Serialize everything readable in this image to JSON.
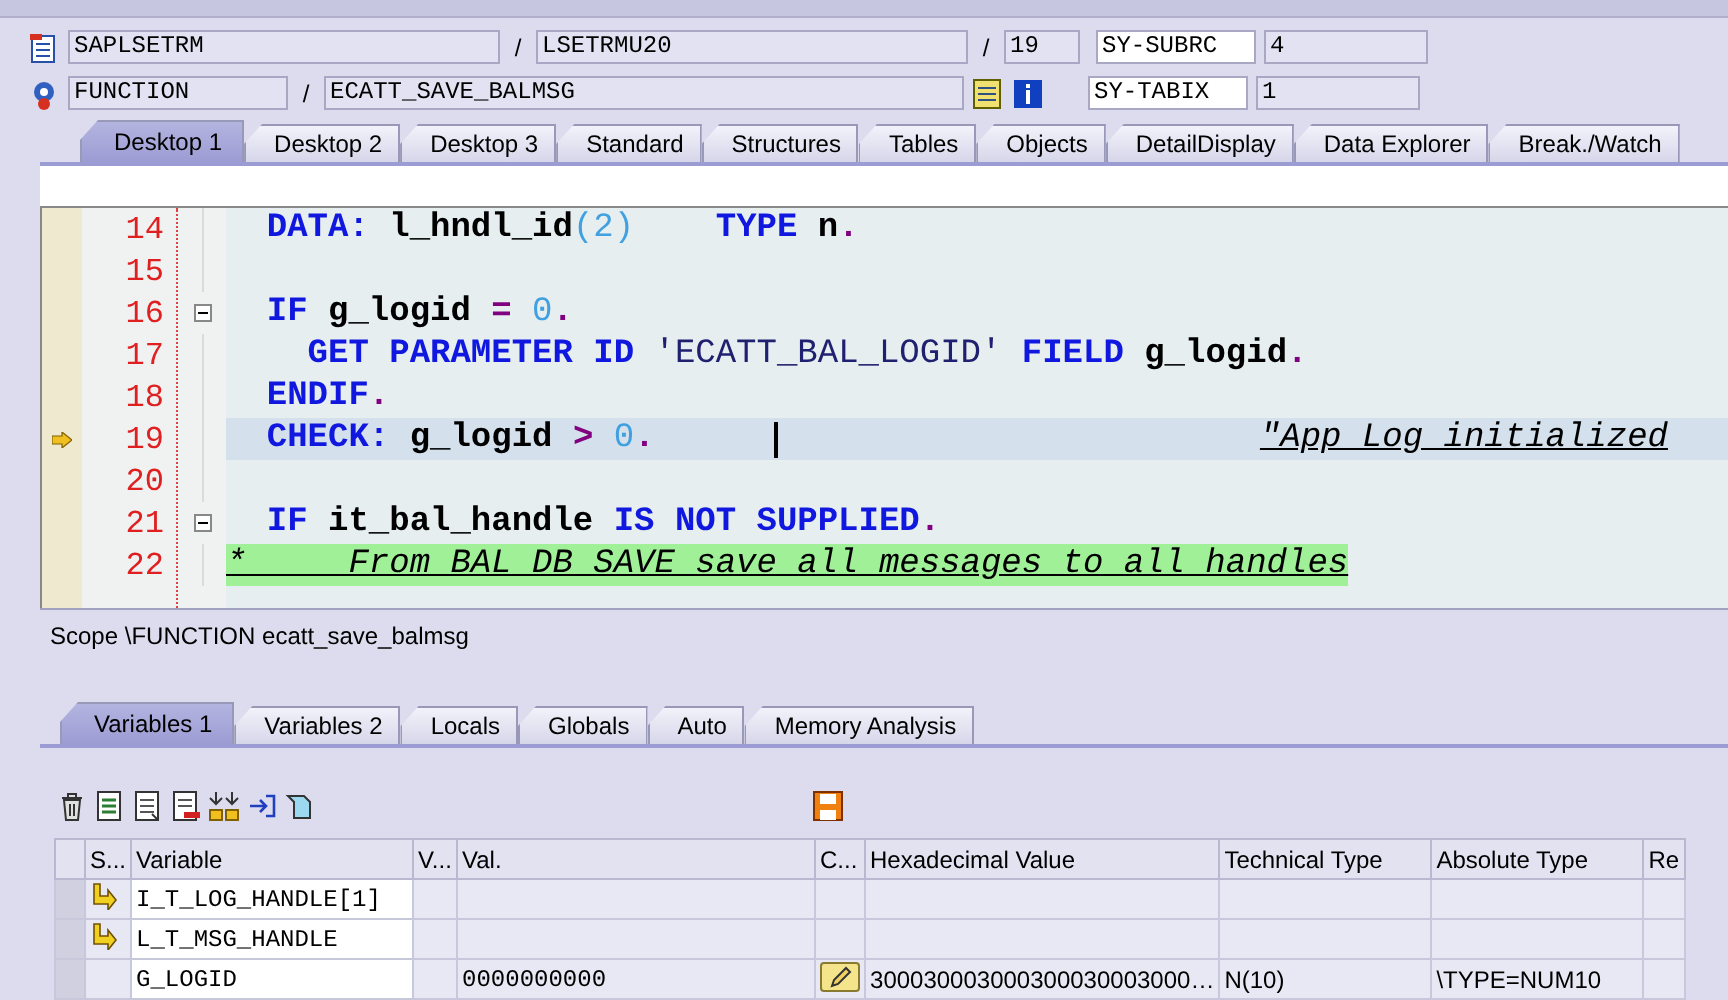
{
  "header": {
    "program_line": {
      "program": "SAPLSETRM",
      "separator_1": "/",
      "include": "LSETRMU20",
      "separator_2": "/",
      "line": "19",
      "system_field": {
        "name": "SY-SUBRC",
        "value": "4"
      }
    },
    "event_line": {
      "event_type": "FUNCTION",
      "separator": "/",
      "event": "ECATT_SAVE_BALMSG",
      "system_field": {
        "name": "SY-TABIX",
        "value": "1"
      }
    }
  },
  "desktop_tabs": [
    {
      "label": "Desktop 1",
      "selected": true
    },
    {
      "label": "Desktop 2",
      "selected": false
    },
    {
      "label": "Desktop 3",
      "selected": false
    },
    {
      "label": "Standard",
      "selected": false
    },
    {
      "label": "Structures",
      "selected": false
    },
    {
      "label": "Tables",
      "selected": false
    },
    {
      "label": "Objects",
      "selected": false
    },
    {
      "label": "DetailDisplay",
      "selected": false
    },
    {
      "label": "Data Explorer",
      "selected": false
    },
    {
      "label": "Break./Watch",
      "selected": false
    }
  ],
  "code": {
    "lines": [
      {
        "number": "14",
        "current": false,
        "fold": false,
        "kind": "code",
        "tokens": [
          {
            "kind": "keyword",
            "text": "  DATA:"
          },
          {
            "kind": "name",
            "text": " l_hndl_id"
          },
          {
            "kind": "number",
            "text": "(2)"
          },
          {
            "kind": "keyword",
            "text": "    TYPE"
          },
          {
            "kind": "name",
            "text": " n"
          },
          {
            "kind": "operator",
            "text": "."
          }
        ]
      },
      {
        "number": "15",
        "current": false,
        "fold": false
      },
      {
        "number": "16",
        "current": false,
        "fold": true,
        "kind": "code",
        "tokens": [
          {
            "kind": "keyword",
            "text": "  IF"
          },
          {
            "kind": "name",
            "text": " g_logid"
          },
          {
            "kind": "operator",
            "text": " ="
          },
          {
            "kind": "number",
            "text": " 0"
          },
          {
            "kind": "operator",
            "text": "."
          }
        ]
      },
      {
        "number": "17",
        "current": false,
        "fold": false,
        "kind": "code",
        "tokens": [
          {
            "kind": "keyword",
            "text": "    GET PARAMETER ID"
          },
          {
            "kind": "string",
            "text": " 'ECATT_BAL_LOGID'"
          },
          {
            "kind": "keyword",
            "text": " FIELD"
          },
          {
            "kind": "name",
            "text": " g_logid"
          },
          {
            "kind": "operator",
            "text": "."
          }
        ]
      },
      {
        "number": "18",
        "current": false,
        "fold": false,
        "kind": "code",
        "tokens": [
          {
            "kind": "keyword",
            "text": "  ENDIF"
          },
          {
            "kind": "operator",
            "text": "."
          }
        ]
      },
      {
        "number": "19",
        "current": true,
        "fold": false,
        "kind": "code",
        "tokens": [
          {
            "kind": "keyword",
            "text": "  CHECK:"
          },
          {
            "kind": "name",
            "text": " g_logid"
          },
          {
            "kind": "operator",
            "text": " >"
          },
          {
            "kind": "number",
            "text": " 0"
          },
          {
            "kind": "operator",
            "text": "."
          }
        ],
        "end_comment": "\"App Log initialized"
      },
      {
        "number": "20",
        "current": false,
        "fold": false
      },
      {
        "number": "21",
        "current": false,
        "fold": true,
        "kind": "code",
        "tokens": [
          {
            "kind": "keyword",
            "text": "  IF"
          },
          {
            "kind": "name",
            "text": " it_bal_handle"
          },
          {
            "kind": "keyword",
            "text": " IS NOT SUPPLIED"
          },
          {
            "kind": "operator",
            "text": "."
          }
        ]
      },
      {
        "number": "22",
        "current": false,
        "fold": false,
        "kind": "comment",
        "tokens": [
          {
            "kind": "comment",
            "text": "*     From BAL DB SAVE save all messages to all handles"
          }
        ]
      }
    ]
  },
  "scope": "Scope \\FUNCTION ecatt_save_balmsg",
  "variable_tabs": [
    {
      "label": "Variables 1",
      "selected": true
    },
    {
      "label": "Variables 2",
      "selected": false
    },
    {
      "label": "Locals",
      "selected": false
    },
    {
      "label": "Globals",
      "selected": false
    },
    {
      "label": "Auto",
      "selected": false
    },
    {
      "label": "Memory Analysis",
      "selected": false
    }
  ],
  "table": {
    "columns": [
      "S...",
      "Variable",
      "V...",
      "Val.",
      "C...",
      "Hexadecimal Value",
      "Technical Type",
      "Absolute Type",
      "Re"
    ],
    "rows": [
      {
        "kind": "reference",
        "variable": "I_T_LOG_HANDLE[1]"
      },
      {
        "kind": "reference",
        "variable": "L_T_MSG_HANDLE"
      },
      {
        "kind": "value",
        "variable": "G_LOGID",
        "value": "0000000000",
        "hex": "300030003000300030003000…",
        "technical_type": "N(10)",
        "absolute_type": "\\TYPE=NUM10"
      }
    ]
  }
}
